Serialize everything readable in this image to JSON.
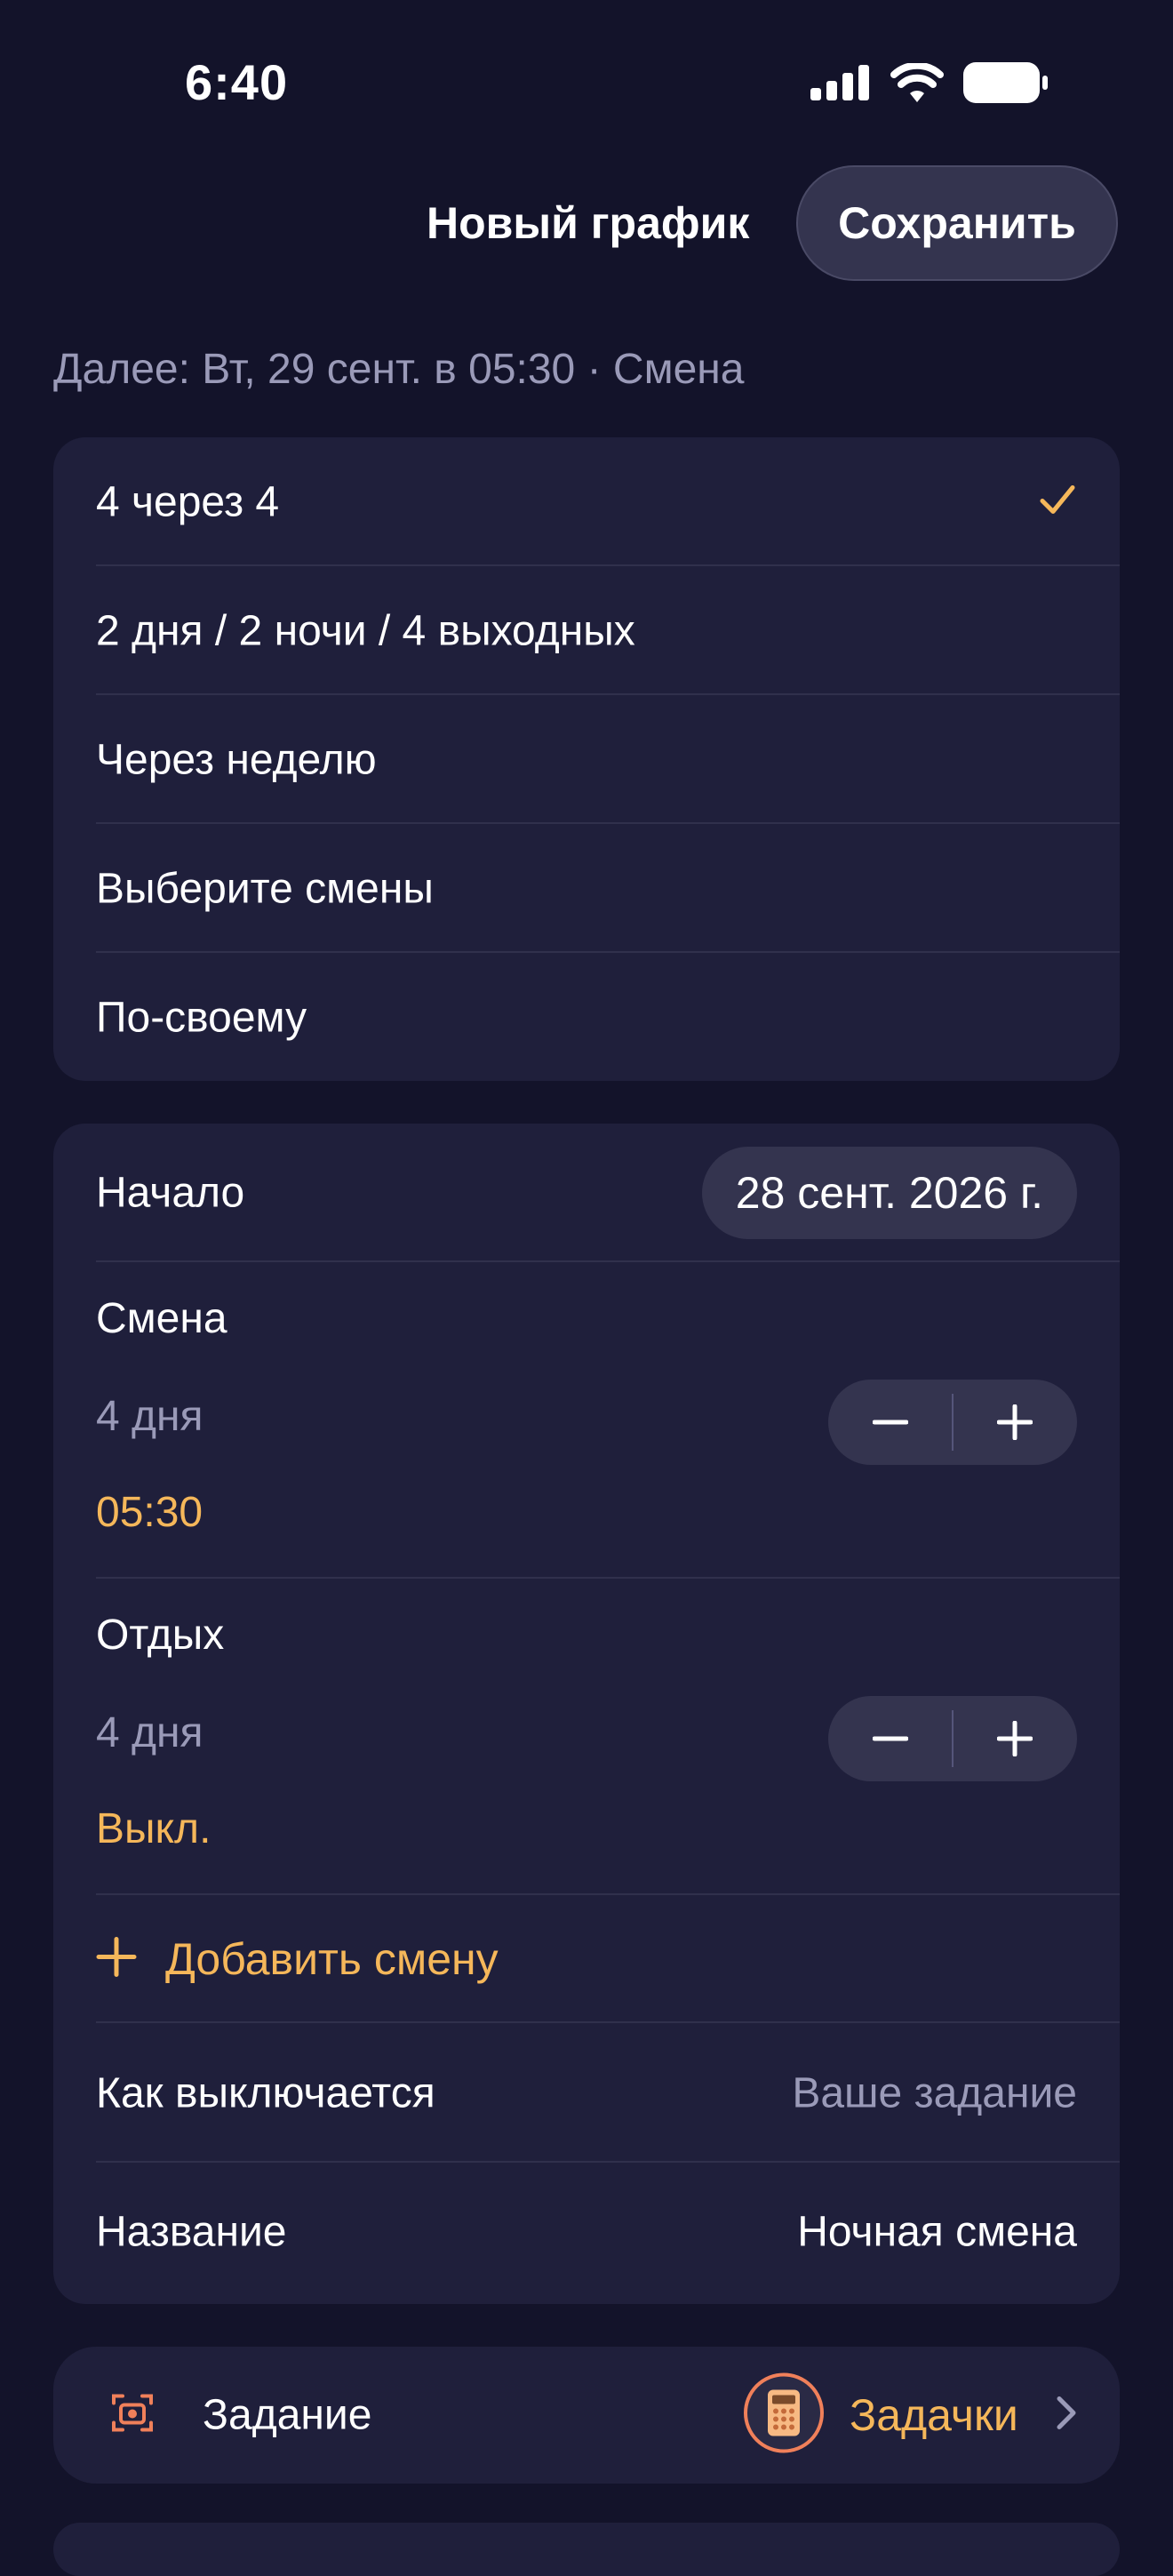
{
  "status": {
    "time": "6:40"
  },
  "header": {
    "title": "Новый график",
    "save_label": "Сохранить"
  },
  "subtitle": "Далее: Вт, 29 сент. в 05:30 · Смена",
  "patterns": {
    "items": [
      {
        "label": "4 через 4",
        "selected": true
      },
      {
        "label": "2 дня / 2 ночи / 4 выходных",
        "selected": false
      },
      {
        "label": "Через неделю",
        "selected": false
      },
      {
        "label": "Выберите смены",
        "selected": false
      },
      {
        "label": "По-своему",
        "selected": false
      }
    ]
  },
  "schedule": {
    "start_label": "Начало",
    "start_value": "28 сент. 2026 г.",
    "shift": {
      "label": "Смена",
      "duration": "4 дня",
      "time": "05:30"
    },
    "rest": {
      "label": "Отдых",
      "duration": "4 дня",
      "time": "Выкл."
    },
    "add_shift_label": "Добавить смену",
    "dismiss": {
      "label": "Как выключается",
      "value": "Ваше задание"
    },
    "name": {
      "label": "Название",
      "value": "Ночная смена"
    }
  },
  "task": {
    "label": "Задание",
    "value": "Задачки",
    "icon": "camera-scan-icon",
    "badge_icon": "calculator-icon"
  },
  "colors": {
    "accent": "#f5b75a",
    "background": "#13132a",
    "card": "#1f1f3b",
    "muted": "#9a9ab8"
  }
}
